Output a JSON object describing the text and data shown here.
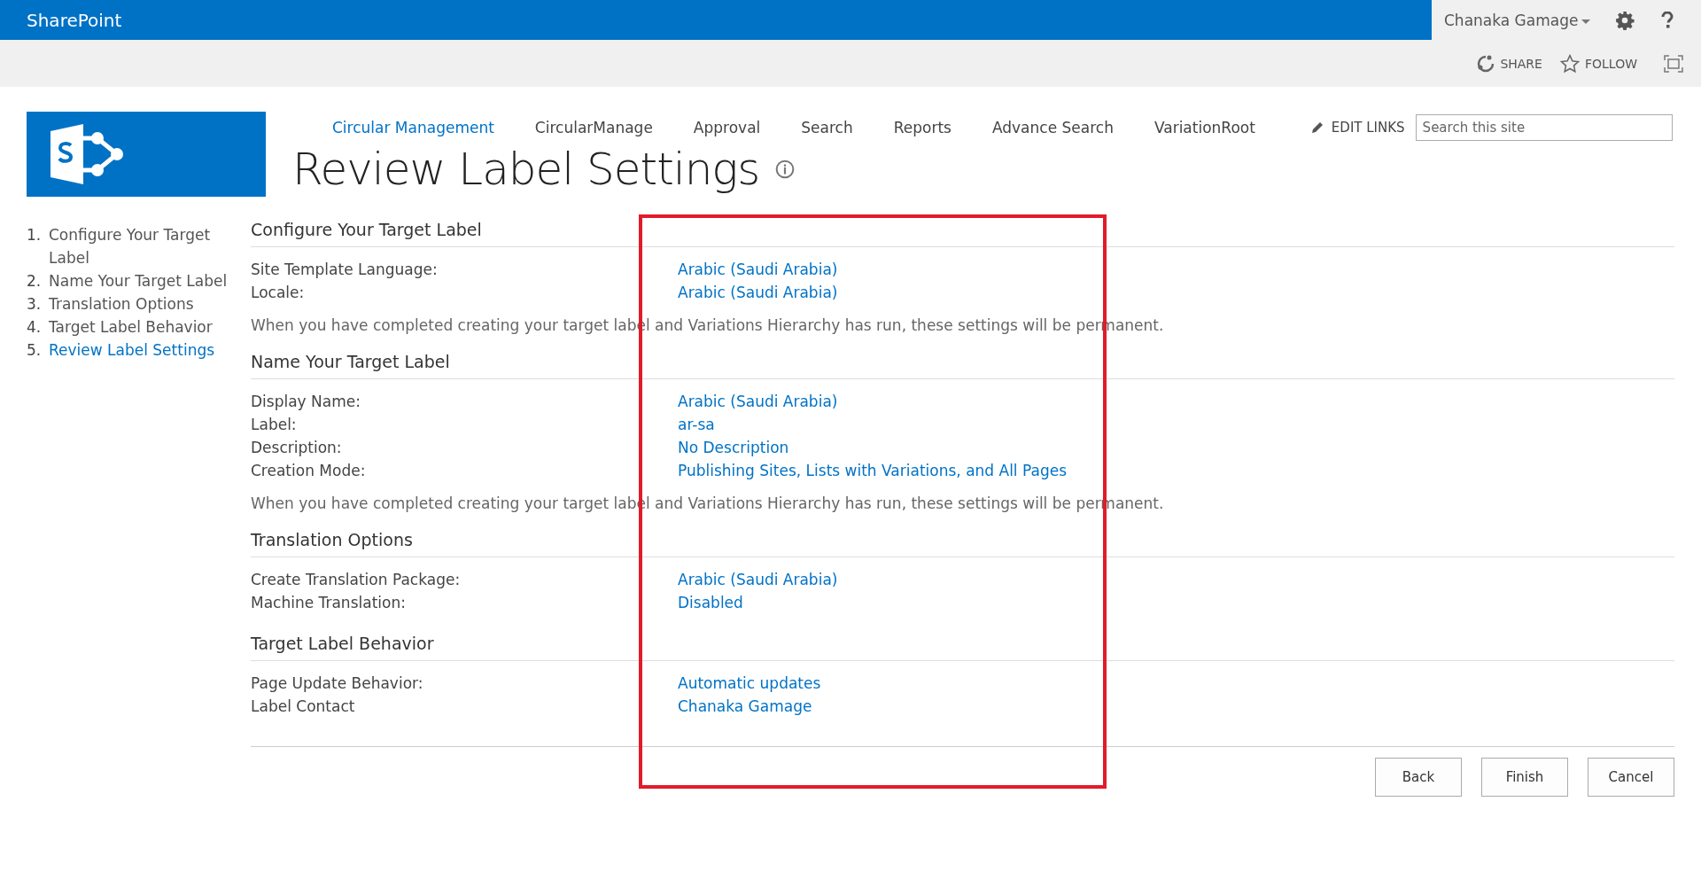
{
  "suite_bar": {
    "brand": "SharePoint",
    "user": "Chanaka Gamage"
  },
  "action_bar": {
    "actions": [
      "SHARE",
      "FOLLOW"
    ]
  },
  "nav": {
    "items": [
      {
        "label": "Circular Management",
        "selected": true
      },
      {
        "label": "CircularManage",
        "selected": false
      },
      {
        "label": "Approval",
        "selected": false
      },
      {
        "label": "Search",
        "selected": false
      },
      {
        "label": "Reports",
        "selected": false
      },
      {
        "label": "Advance Search",
        "selected": false
      },
      {
        "label": "VariationRoot",
        "selected": false
      }
    ],
    "edit_links": "EDIT LINKS",
    "search_placeholder": "Search this site"
  },
  "page_title": "Review Label Settings",
  "steps": [
    {
      "number": "1.",
      "label": "Configure Your Target Label",
      "selected": false
    },
    {
      "number": "2.",
      "label": "Name Your Target Label",
      "selected": false
    },
    {
      "number": "3.",
      "label": "Translation Options",
      "selected": false
    },
    {
      "number": "4.",
      "label": "Target Label Behavior",
      "selected": false
    },
    {
      "number": "5.",
      "label": "Review Label Settings",
      "selected": true
    }
  ],
  "sections": [
    {
      "heading": "Configure Your Target Label",
      "rows": [
        {
          "label": "Site Template Language:",
          "value": "Arabic (Saudi Arabia)"
        },
        {
          "label": "Locale:",
          "value": "Arabic (Saudi Arabia)"
        }
      ],
      "note": "When you have completed creating your target label and Variations Hierarchy has run, these settings will be permanent."
    },
    {
      "heading": "Name Your Target Label",
      "rows": [
        {
          "label": "Display Name:",
          "value": "Arabic (Saudi Arabia)"
        },
        {
          "label": "Label:",
          "value": "ar-sa"
        },
        {
          "label": "Description:",
          "value": "No Description"
        },
        {
          "label": "Creation Mode:",
          "value": "Publishing Sites, Lists with Variations, and All Pages"
        }
      ],
      "note": "When you have completed creating your target label and Variations Hierarchy has run, these settings will be permanent."
    },
    {
      "heading": "Translation Options",
      "rows": [
        {
          "label": "Create Translation Package:",
          "value": "Arabic (Saudi Arabia)"
        },
        {
          "label": "Machine Translation:",
          "value": "Disabled"
        }
      ]
    },
    {
      "heading": "Target Label Behavior",
      "rows": [
        {
          "label": "Page Update Behavior:",
          "value": "Automatic updates"
        },
        {
          "label": "Label Contact",
          "value": "Chanaka Gamage"
        }
      ]
    }
  ],
  "buttons": [
    "Back",
    "Finish",
    "Cancel"
  ]
}
